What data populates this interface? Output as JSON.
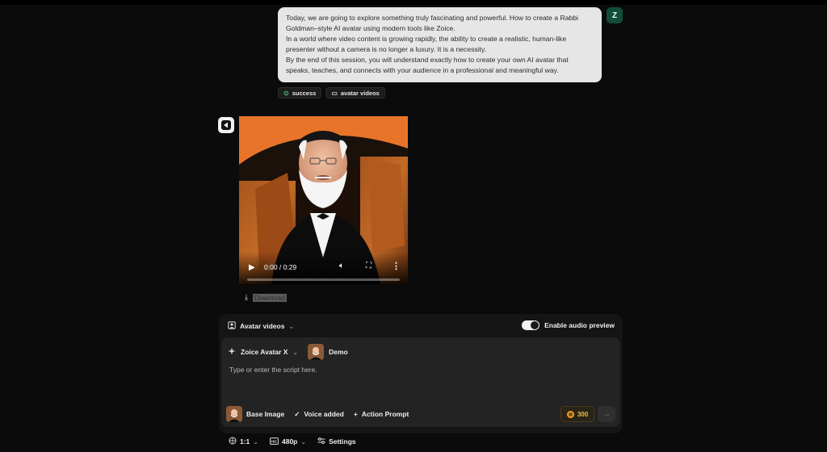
{
  "message": {
    "user_initial": "Z",
    "paragraphs": [
      "Today, we are going to explore something truly fascinating and powerful. How to create a Rabbi Goldman–style AI avatar using modern tools like Zoice.",
      "In a world where video content is growing rapidly, the ability to create a realistic, human-like presenter without a camera is no longer a luxury. It is a necessity.",
      "By the end of this session, you will understand exactly how to create your own AI avatar that speaks, teaches, and connects with your audience in a professional and meaningful way."
    ],
    "tags": [
      "success",
      "avatar videos"
    ]
  },
  "video": {
    "time": "0:00 / 0:29",
    "progress": 0.0,
    "download_label": "Download"
  },
  "composer": {
    "mode": "Avatar videos",
    "audio_preview_label": "Enable audio preview",
    "audio_preview_on": true,
    "model": "Zoice Avatar X",
    "avatar_name": "Demo",
    "placeholder": "Type or enter the script here.",
    "base_image_label": "Base Image",
    "voice_label": "Voice added",
    "action_prompt_label": "Action Prompt",
    "credits": "300"
  },
  "settings": {
    "ratio": "1:1",
    "resolution": "480p",
    "settings_label": "Settings"
  },
  "colors": {
    "background": "#0b0b0b",
    "bubble": "#e6e6e6",
    "user_avatar": "#114d38",
    "success": "#4fbf7a",
    "credits": "#f0c040"
  },
  "icons": {
    "tag_success": "check-circle-icon",
    "tag_avatar": "video-icon",
    "bot": "zoice-logo-icon",
    "download": "download-icon",
    "mode": "portrait-icon",
    "model": "sparkle-icon",
    "voice": "checkmark-icon",
    "action": "plus-icon",
    "credits": "coin-icon",
    "send": "arrow-right-icon",
    "ratio": "aspect-ratio-icon",
    "resolution": "resolution-icon",
    "settings": "sliders-icon"
  }
}
